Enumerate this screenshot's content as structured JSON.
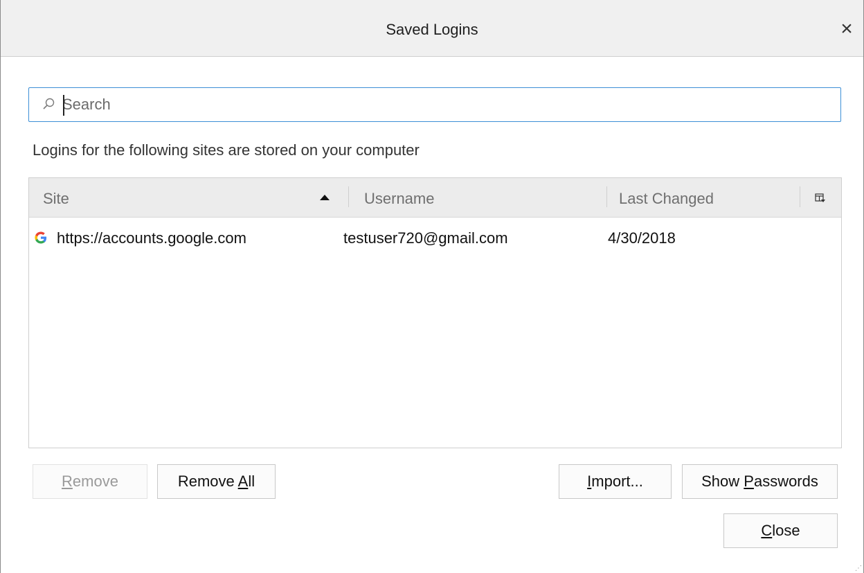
{
  "window": {
    "title": "Saved Logins",
    "close_symbol": "×"
  },
  "search": {
    "placeholder": "Search",
    "value": "",
    "icon": "search-icon"
  },
  "description": "Logins for the following sites are stored on your computer",
  "table": {
    "columns": [
      {
        "label": "Site",
        "sorted": "ascending"
      },
      {
        "label": "Username"
      },
      {
        "label": "Last Changed"
      }
    ],
    "column_picker_icon": "column-picker-icon",
    "rows": [
      {
        "icon": "google-icon",
        "site": "https://accounts.google.com",
        "username": "testuser720@gmail.com",
        "last_changed": "4/30/2018"
      }
    ]
  },
  "buttons": {
    "remove": {
      "prefix": "",
      "accel": "R",
      "suffix": "emove",
      "enabled": false
    },
    "remove_all": {
      "prefix": "Remove ",
      "accel": "A",
      "suffix": "ll",
      "enabled": true
    },
    "import": {
      "prefix": "",
      "accel": "I",
      "suffix": "mport...",
      "enabled": true
    },
    "show_passwords": {
      "prefix": "Show ",
      "accel": "P",
      "suffix": "asswords",
      "enabled": true
    },
    "close": {
      "prefix": "",
      "accel": "C",
      "suffix": "lose",
      "enabled": true
    }
  },
  "colors": {
    "search_focus_border": "#3c8fd6",
    "header_background": "#ececec",
    "titlebar_background": "#f0f0f0"
  }
}
